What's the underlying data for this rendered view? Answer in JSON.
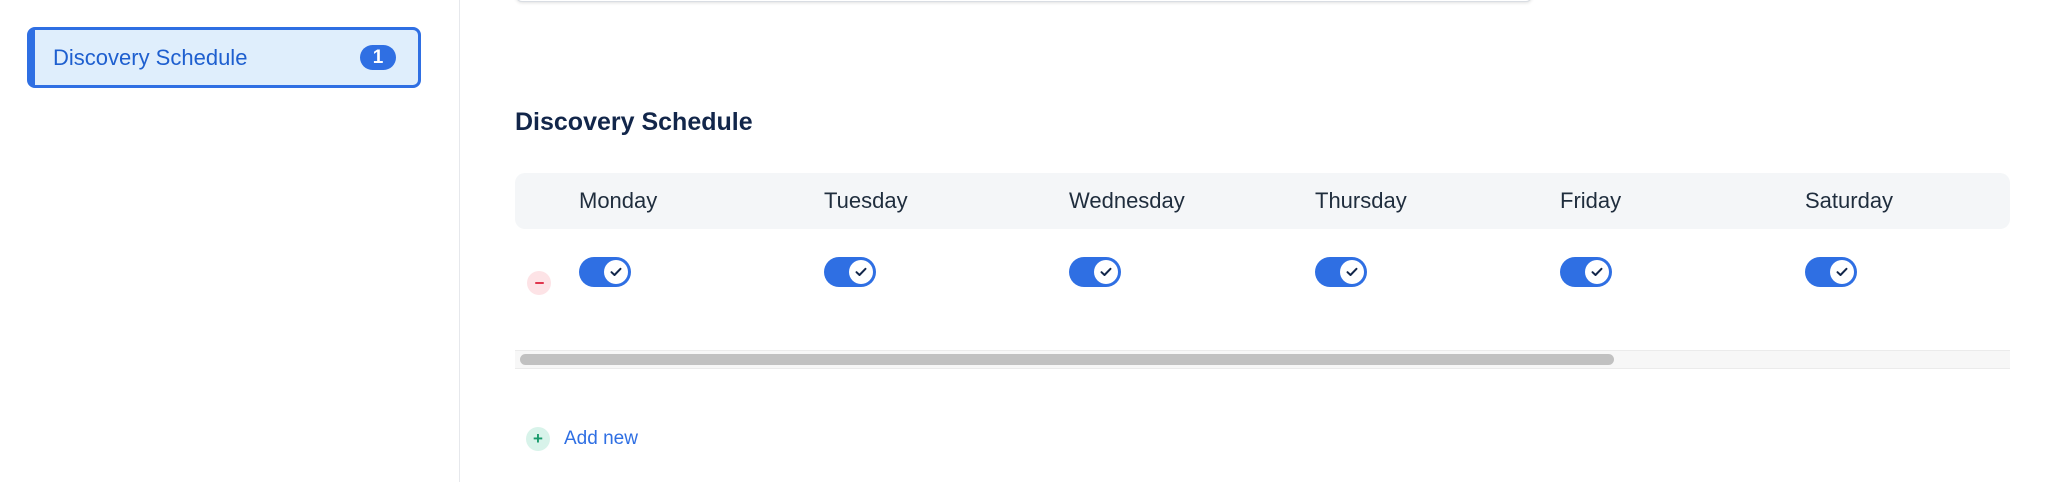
{
  "sidebar": {
    "items": [
      {
        "label": "Discovery Schedule",
        "count": "1"
      }
    ]
  },
  "main": {
    "section_title": "Discovery Schedule",
    "days": [
      {
        "label": "Monday",
        "enabled": true
      },
      {
        "label": "Tuesday",
        "enabled": true
      },
      {
        "label": "Wednesday",
        "enabled": true
      },
      {
        "label": "Thursday",
        "enabled": true
      },
      {
        "label": "Friday",
        "enabled": true
      },
      {
        "label": "Saturday",
        "enabled": true
      }
    ],
    "add_new_label": "Add new",
    "add_icon": "+"
  },
  "colors": {
    "accent": "#2f6fe3",
    "remove": "#e0364e",
    "add": "#179a6b"
  }
}
